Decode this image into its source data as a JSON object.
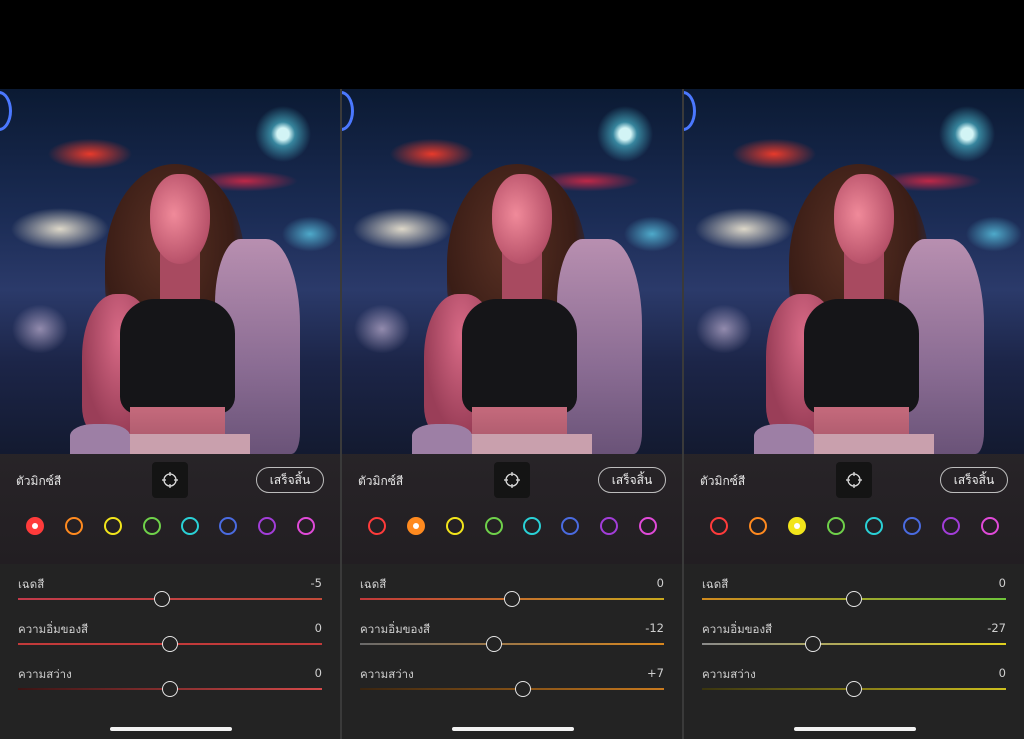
{
  "colors": {
    "red": "#ff3b3b",
    "orange": "#ff8a1f",
    "yellow": "#f2e51b",
    "green": "#6fd14a",
    "aqua": "#2ad1d6",
    "blue": "#4a6be0",
    "purple": "#a23dd8",
    "magenta": "#e04ad8"
  },
  "panels": [
    {
      "mixer_title": "ตัวมิกซ์สี",
      "done_label": "เสร็จสิ้น",
      "selected_color": "red",
      "sliders": [
        {
          "label": "เฉดสี",
          "value_text": "-5",
          "level": -5,
          "range": [
            -100,
            100
          ]
        },
        {
          "label": "ความอิ่มของสี",
          "value_text": "0",
          "level": 0,
          "range": [
            -100,
            100
          ]
        },
        {
          "label": "ความสว่าง",
          "value_text": "0",
          "level": 0,
          "range": [
            -100,
            100
          ]
        }
      ]
    },
    {
      "mixer_title": "ตัวมิกซ์สี",
      "done_label": "เสร็จสิ้น",
      "selected_color": "orange",
      "sliders": [
        {
          "label": "เฉดสี",
          "value_text": "0",
          "level": 0,
          "range": [
            -100,
            100
          ]
        },
        {
          "label": "ความอิ่มของสี",
          "value_text": "-12",
          "level": -12,
          "range": [
            -100,
            100
          ]
        },
        {
          "label": "ความสว่าง",
          "value_text": "+7",
          "level": 7,
          "range": [
            -100,
            100
          ]
        }
      ]
    },
    {
      "mixer_title": "ตัวมิกซ์สี",
      "done_label": "เสร็จสิ้น",
      "selected_color": "yellow",
      "sliders": [
        {
          "label": "เฉดสี",
          "value_text": "0",
          "level": 0,
          "range": [
            -100,
            100
          ]
        },
        {
          "label": "ความอิ่มของสี",
          "value_text": "-27",
          "level": -27,
          "range": [
            -100,
            100
          ]
        },
        {
          "label": "ความสว่าง",
          "value_text": "0",
          "level": 0,
          "range": [
            -100,
            100
          ]
        }
      ]
    }
  ],
  "swatch_order": [
    "red",
    "orange",
    "yellow",
    "green",
    "aqua",
    "blue",
    "purple",
    "magenta"
  ],
  "icons": {
    "target": "target-adjust-icon"
  }
}
